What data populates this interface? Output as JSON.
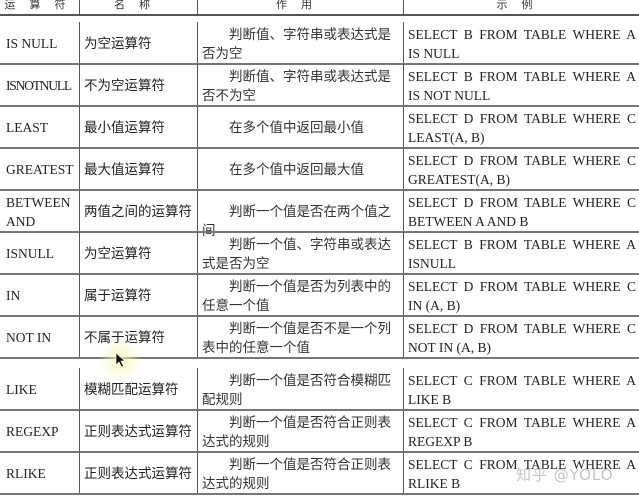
{
  "table": {
    "headers": [
      "运算符",
      "名称",
      "作用",
      "示例"
    ],
    "rows": [
      {
        "operator": "IS NULL",
        "name": "为空运算符",
        "purpose": "判断值、字符串或表达式是否为空",
        "example_line1": "SELECT B FROM TABLE WHERE A",
        "example_line2": "IS NULL"
      },
      {
        "operator": "ISNOTNULL",
        "name": "不为空运算符",
        "purpose": "判断值、字符串或表达式是否不为空",
        "example_line1": "SELECT B FROM TABLE WHERE A",
        "example_line2": "IS NOT NULL"
      },
      {
        "operator": "LEAST",
        "name": "最小值运算符",
        "purpose": "在多个值中返回最小值",
        "example_line1": "SELECT D FROM TABLE WHERE C",
        "example_line2": "LEAST(A, B)"
      },
      {
        "operator": "GREATEST",
        "name": "最大值运算符",
        "purpose": "在多个值中返回最大值",
        "example_line1": "SELECT D FROM TABLE WHERE C",
        "example_line2": "GREATEST(A, B)"
      },
      {
        "operator": "BETWEEN AND",
        "name": "两值之间的运算符",
        "purpose": "判断一个值是否在两个值之间",
        "example_line1": "SELECT D FROM TABLE WHERE C",
        "example_line2": "BETWEEN A AND B"
      },
      {
        "operator": "ISNULL",
        "name": "为空运算符",
        "purpose": "判断一个值、字符串或表达式是否为空",
        "example_line1": "SELECT B FROM TABLE WHERE A",
        "example_line2": "ISNULL"
      },
      {
        "operator": "IN",
        "name": "属于运算符",
        "purpose": "判断一个值是否为列表中的任意一个值",
        "example_line1": "SELECT D FROM TABLE WHERE C",
        "example_line2": "IN (A, B)"
      },
      {
        "operator": "NOT IN",
        "name": "不属于运算符",
        "purpose": "判断一个值是否不是一个列表中的任意一个值",
        "example_line1": "SELECT D FROM TABLE WHERE C",
        "example_line2": "NOT IN (A, B)"
      },
      {
        "operator": "LIKE",
        "name": "模糊匹配运算符",
        "purpose": "判断一个值是否符合模糊匹配规则",
        "example_line1": "SELECT C FROM TABLE WHERE A",
        "example_line2": "LIKE B"
      },
      {
        "operator": "REGEXP",
        "name": "正则表达式运算符",
        "purpose": "判断一个值是否符合正则表达式的规则",
        "example_line1": "SELECT C FROM TABLE WHERE A",
        "example_line2": "REGEXP B"
      },
      {
        "operator": "RLIKE",
        "name": "正则表达式运算符",
        "purpose": "判断一个值是否符合正则表达式的规则",
        "example_line1": "SELECT C FROM TABLE WHERE A",
        "example_line2": "RLIKE B"
      }
    ]
  },
  "watermark": "知乎 @YOLO"
}
